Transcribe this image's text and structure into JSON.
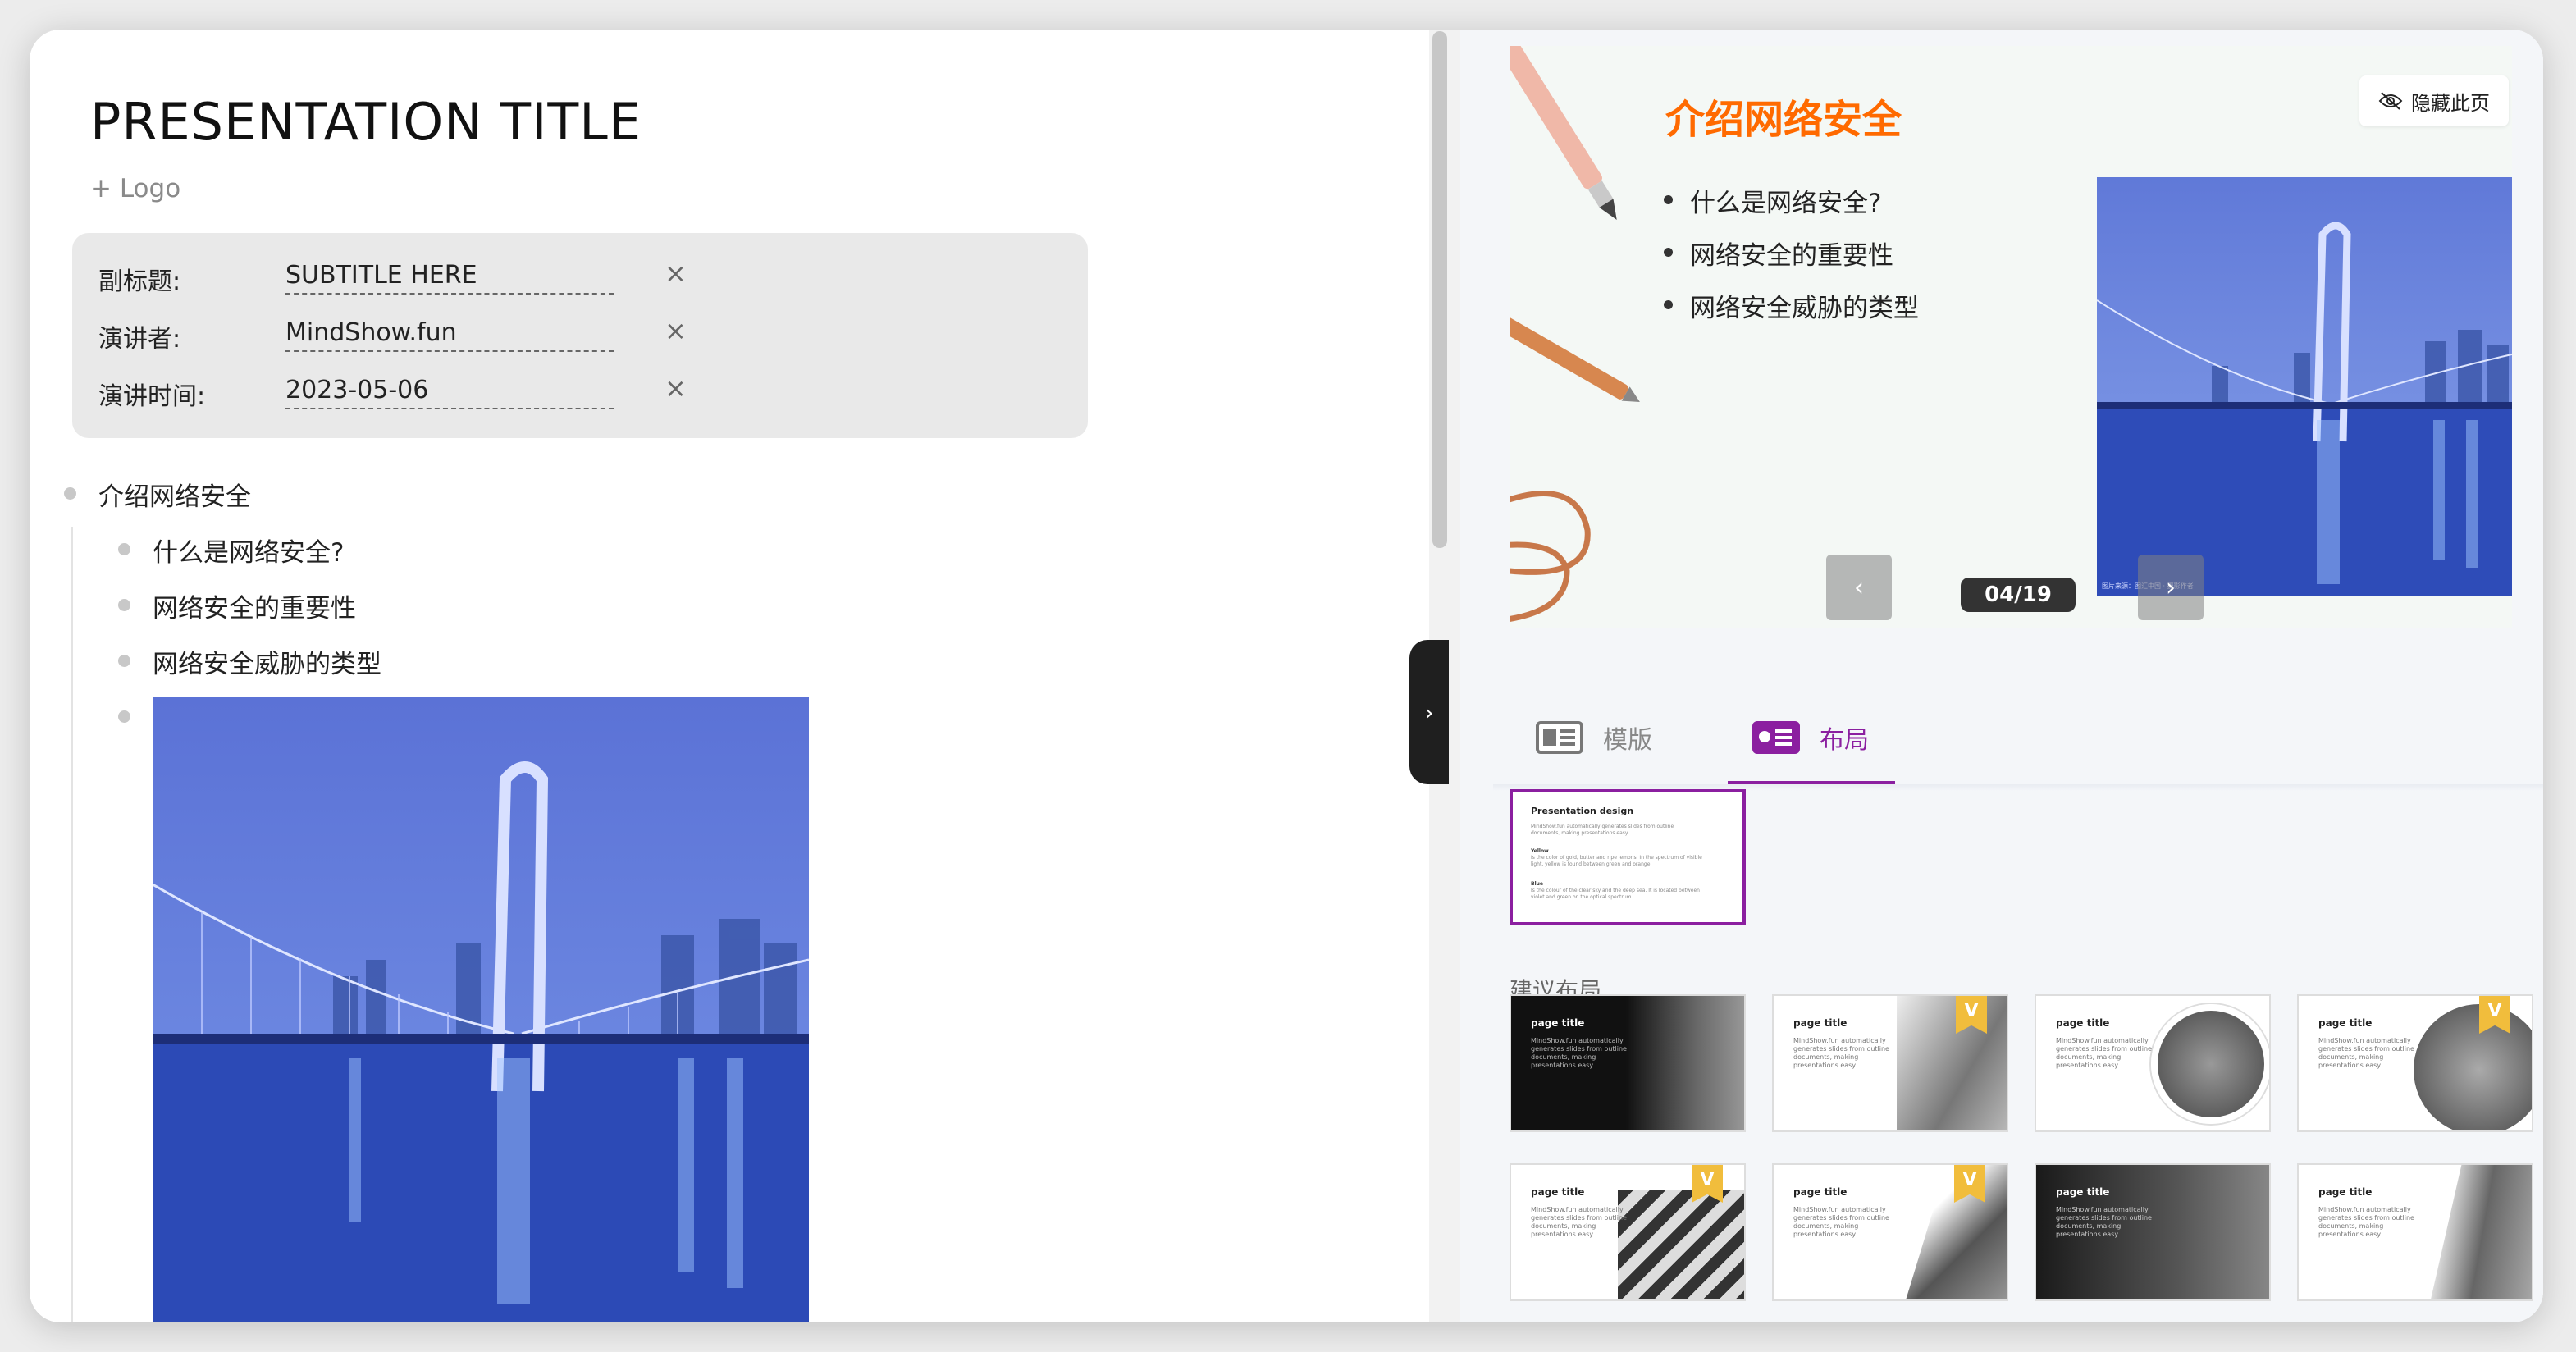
{
  "editor": {
    "title": "PRESENTATION TITLE",
    "logo_link": "+ Logo",
    "meta": [
      {
        "label": "副标题:",
        "value": "SUBTITLE HERE"
      },
      {
        "label": "演讲者:",
        "value": "MindShow.fun"
      },
      {
        "label": "演讲时间:",
        "value": "2023-05-06"
      }
    ],
    "clear_icon": "×",
    "outline": {
      "heading": "介绍网络安全",
      "items": [
        "什么是网络安全?",
        "网络安全的重要性",
        "网络安全威胁的类型"
      ]
    },
    "image_icon": "bridge-photo"
  },
  "preview": {
    "title": "介绍网络安全",
    "bullets": [
      "什么是网络安全?",
      "网络安全的重要性",
      "网络安全威胁的类型"
    ],
    "hide_button": "隐藏此页",
    "page_counter": "04/19",
    "prev_icon": "‹",
    "next_icon": "›",
    "image_caption": "图片来源：图汇中国 · 摄影作者"
  },
  "tabs": {
    "template_label": "模版",
    "layout_label": "布局",
    "active": "布局"
  },
  "layouts": {
    "selected": {
      "title": "Presentation design",
      "body": "MindShow.fun automatically generates slides from outline documents, making presentations easy.",
      "item1_title": "Yellow",
      "item1_body": "Is the color of gold, butter and ripe lemons. In the spectrum of visible light, yellow is found between green and orange.",
      "item2_title": "Blue",
      "item2_body": "Is the colour of the clear sky and the deep sea. It is located between violet and green on the optical spectrum."
    },
    "suggest_label": "建议布局",
    "card_title": "page title",
    "card_body": "MindShow.fun automatically generates slides from outline documents, making presentations easy.",
    "vip_badge": "V",
    "cards": [
      {
        "style": "dark",
        "vip": false
      },
      {
        "style": "light",
        "vip": true
      },
      {
        "style": "circle",
        "vip": false
      },
      {
        "style": "circle",
        "vip": true
      },
      {
        "style": "stripes",
        "vip": true
      },
      {
        "style": "diagonal",
        "vip": true
      },
      {
        "style": "dark-full",
        "vip": false
      },
      {
        "style": "light-right",
        "vip": false
      }
    ]
  },
  "colors": {
    "accent_purple": "#8b1fa0",
    "slide_title_orange": "#ff6a00",
    "vip_gold": "#f1bd3c",
    "bridge_blue": "#3f5fc8"
  },
  "collapse_icon": "›"
}
